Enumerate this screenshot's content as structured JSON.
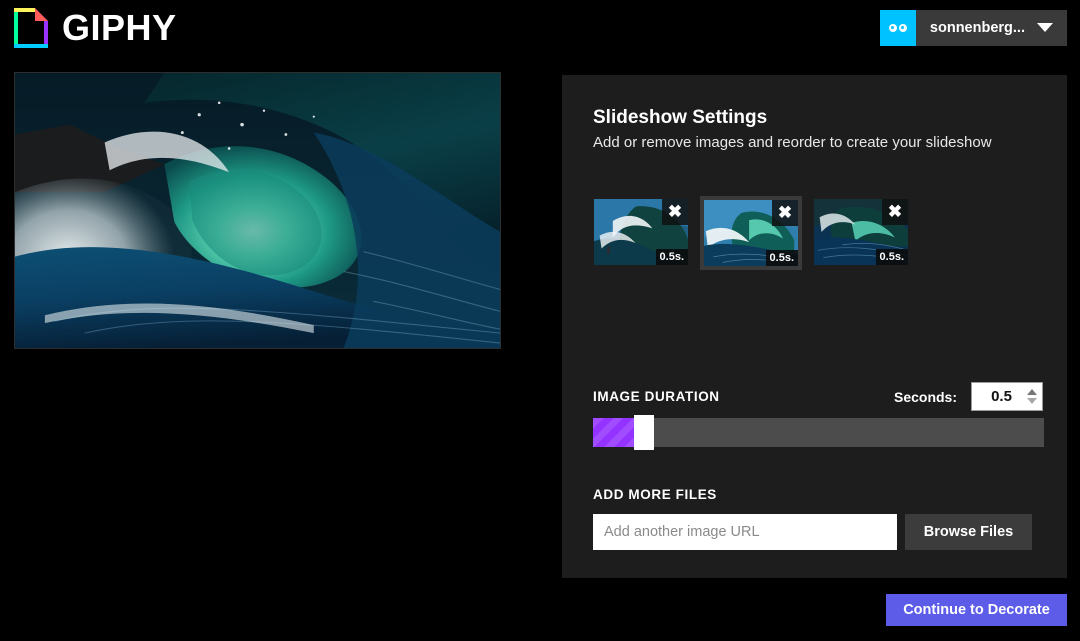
{
  "header": {
    "brand_name": "GIPHY",
    "logo_icon": "giphy-logo-icon",
    "account": {
      "avatar_icon": "goggles-avatar-icon",
      "username": "sonnenberg...",
      "caret_icon": "chevron-down-icon"
    }
  },
  "preview": {
    "alt": "ocean-wave-preview"
  },
  "panel": {
    "title": "Slideshow Settings",
    "subtitle": "Add or remove images and reorder to create your slideshow",
    "thumbnails": [
      {
        "duration": "0.5s.",
        "close_icon": "close-icon",
        "alt": "wave-thumbnail-1",
        "active": false
      },
      {
        "duration": "0.5s.",
        "close_icon": "close-icon",
        "alt": "wave-thumbnail-2",
        "active": true
      },
      {
        "duration": "0.5s.",
        "close_icon": "close-icon",
        "alt": "wave-thumbnail-3",
        "active": false
      }
    ],
    "duration": {
      "label": "IMAGE DURATION",
      "seconds_label": "Seconds:",
      "seconds_value": "0.5",
      "spinner_up_icon": "triangle-up-icon",
      "spinner_down_icon": "triangle-down-icon",
      "slider_fill_color": "#9433ff",
      "slider_track_color": "#4c4c4c",
      "slider_percent": 9
    },
    "add_files": {
      "label": "ADD MORE FILES",
      "url_placeholder": "Add another image URL",
      "url_value": "",
      "browse_label": "Browse Files"
    }
  },
  "footer": {
    "continue_label": "Continue to Decorate",
    "continue_color": "#5c5ce8"
  }
}
